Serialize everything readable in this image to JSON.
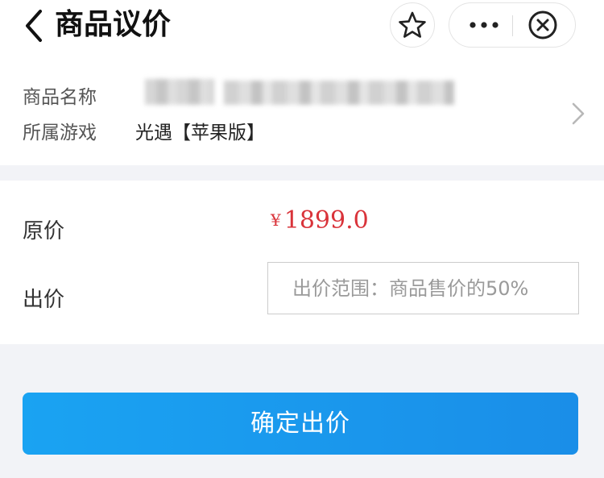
{
  "header": {
    "title": "商品议价",
    "icons": [
      "back-icon",
      "star-icon",
      "more-icon",
      "close-circle-icon"
    ]
  },
  "product": {
    "name_label": "商品名称",
    "game_label": "所属游戏",
    "game_value": "光遇【苹果版】"
  },
  "pricing": {
    "original_label": "原价",
    "currency": "¥",
    "original_value": "1899.0",
    "bid_label": "出价",
    "bid_placeholder": "出价范围：商品售价的50%"
  },
  "actions": {
    "confirm_label": "确定出价"
  },
  "colors": {
    "price": "#d9333a",
    "button": "#1a9bf0",
    "background": "#f2f3f7"
  }
}
